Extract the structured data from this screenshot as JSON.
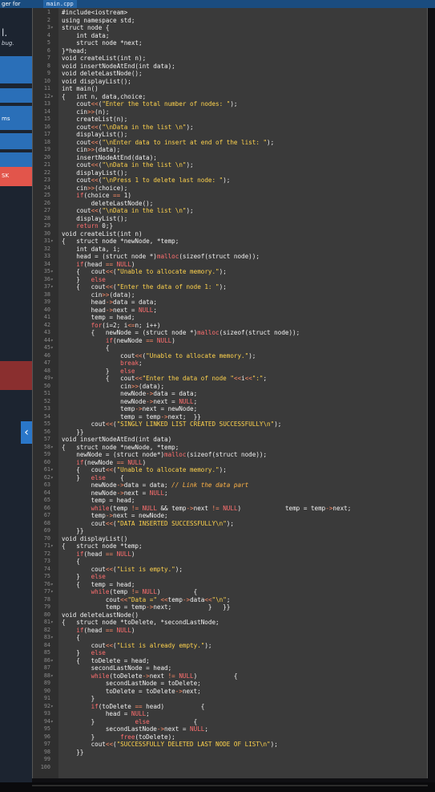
{
  "header": {
    "window_title": "ger for",
    "file_tab": "main.cpp"
  },
  "left_panel": {
    "items": [
      {
        "name": "left-label-l",
        "text": "l."
      },
      {
        "name": "left-label-bug",
        "text": "bug."
      },
      {
        "name": "left-label-ms",
        "text": "ms"
      },
      {
        "name": "left-label-sk",
        "text": "SK"
      }
    ],
    "collapse_glyph": "‹"
  },
  "colors": {
    "keyword": "#f2f2f2",
    "string": "#ffd34d",
    "operator": "#ff8c66",
    "control": "#ff6f6f",
    "comment": "#ffb347",
    "malloc": "#ff6f6f"
  },
  "code": {
    "lines": [
      "#include<iostream>",
      "using namespace std;",
      "struct node {",
      "    int data;",
      "    struct node *next;",
      "}*head;",
      "void createList(int n);",
      "void insertNodeAtEnd(int data);",
      "void deleteLastNode();",
      "void displayList();",
      "int main()",
      "{   int n, data,choice;",
      "    cout<<(\"Enter the total number of nodes: \");",
      "    cin>>(n);",
      "    createList(n);",
      "    cout<<(\"\\nData in the list \\n\");",
      "    displayList();",
      "    cout<<(\"\\nEnter data to insert at end of the list: \");",
      "    cin>>(data);",
      "    insertNodeAtEnd(data);",
      "    cout<<(\"\\nData in the list \\n\");",
      "    displayList();",
      "    cout<<(\"\\nPress 1 to delete last node: \");",
      "    cin>>(choice);",
      "    if(choice == 1)",
      "        deleteLastNode();",
      "    cout<<(\"\\nData in the list \\n\");",
      "    displayList();",
      "    return 0;}",
      "void createList(int n)",
      "{   struct node *newNode, *temp;",
      "    int data, i;",
      "    head = (struct node *)malloc(sizeof(struct node));",
      "    if(head == NULL)",
      "    {   cout<<(\"Unable to allocate memory.\");",
      "    }   else",
      "    {   cout<<(\"Enter the data of node 1: \");",
      "        cin>>(data);",
      "        head->data = data;",
      "        head->next = NULL;",
      "        temp = head;",
      "        for(i=2; i<=n; i++)",
      "        {   newNode = (struct node *)malloc(sizeof(struct node));",
      "            if(newNode == NULL)",
      "            {",
      "                cout<<(\"Unable to allocate memory.\");",
      "                break;",
      "            }   else",
      "            {   cout<<\"Enter the data of node \"<<i<<\":\";",
      "                cin>>(data);",
      "                newNode->data = data;",
      "                newNode->next = NULL;",
      "                temp->next = newNode;",
      "                temp = temp->next;  }}",
      "        cout<<(\"SINGLY LINKED LIST CREATED SUCCESSFULLY\\n\");",
      "    }}",
      "void insertNodeAtEnd(int data)",
      "{   struct node *newNode, *temp;",
      "    newNode = (struct node*)malloc(sizeof(struct node));",
      "    if(newNode == NULL)",
      "    {   cout<<(\"Unable to allocate memory.\");",
      "    }   else    {",
      "        newNode->data = data; // Link the data part",
      "        newNode->next = NULL;",
      "        temp = head;",
      "        while(temp != NULL && temp->next != NULL)            temp = temp->next;",
      "        temp->next = newNode;",
      "        cout<<(\"DATA INSERTED SUCCESSFULLY\\n\");",
      "    }}",
      "void displayList()",
      "{   struct node *temp;",
      "    if(head == NULL)",
      "    {",
      "        cout<<(\"List is empty.\");",
      "    }   else",
      "    {   temp = head;",
      "        while(temp != NULL)         {",
      "            cout<<\"Data =\" <<temp->data<<\"\\n\";",
      "            temp = temp->next;          }   }}",
      "void deleteLastNode()",
      "{   struct node *toDelete, *secondLastNode;",
      "    if(head == NULL)",
      "    {",
      "        cout<<(\"List is already empty.\");",
      "    }   else",
      "    {   toDelete = head;",
      "        secondLastNode = head;",
      "        while(toDelete->next != NULL)          {",
      "            secondLastNode = toDelete;",
      "            toDelete = toDelete->next;",
      "        }",
      "        if(toDelete == head)          {",
      "            head = NULL;",
      "        }           else            {",
      "            secondLastNode->next = NULL;",
      "        }       free(toDelete);",
      "        cout<<(\"SUCCESSFULLY DELETED LAST NODE OF LIST\\n\");",
      "    }}",
      "",
      ""
    ],
    "fold_lines": [
      3,
      12,
      31,
      35,
      36,
      37,
      44,
      45,
      49,
      58,
      61,
      62,
      71,
      76,
      77,
      81,
      83,
      86,
      88,
      92,
      94
    ]
  }
}
